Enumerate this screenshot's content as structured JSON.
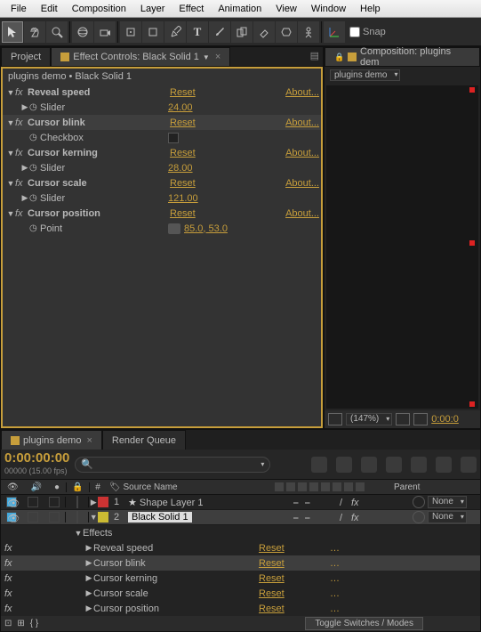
{
  "menu": [
    "File",
    "Edit",
    "Composition",
    "Layer",
    "Effect",
    "Animation",
    "View",
    "Window",
    "Help"
  ],
  "snap_label": "Snap",
  "tabs_left": {
    "project": "Project",
    "effect": "Effect Controls: Black Solid 1"
  },
  "tabs_right": {
    "comp": "Composition: plugins dem",
    "pill": "plugins demo"
  },
  "breadcrumb": "plugins demo • Black Solid 1",
  "effects": [
    {
      "name": "Reveal speed",
      "reset": "Reset",
      "about": "About...",
      "child": "Slider",
      "val": "24.00"
    },
    {
      "name": "Cursor blink",
      "reset": "Reset",
      "about": "About...",
      "child": "Checkbox",
      "ctl": "chk",
      "hl": true
    },
    {
      "name": "Cursor kerning",
      "reset": "Reset",
      "about": "About...",
      "child": "Slider",
      "val": "28.00"
    },
    {
      "name": "Cursor scale",
      "reset": "Reset",
      "about": "About...",
      "child": "Slider",
      "val": "121.00"
    },
    {
      "name": "Cursor position",
      "reset": "Reset",
      "about": "About...",
      "child": "Point",
      "val": "85.0, 53.0",
      "ctl": "cross"
    }
  ],
  "comp_zoom": "(147%)",
  "comp_time": "0:00:0",
  "tl_tabs": {
    "demo": "plugins demo",
    "rq": "Render Queue"
  },
  "timecode": "0:00:00:00",
  "timesub": "00000 (15.00 fps)",
  "columns": {
    "num": "#",
    "source": "Source Name",
    "parent": "Parent"
  },
  "layers": [
    {
      "n": "1",
      "name": "Shape Layer 1",
      "color": "red",
      "star": true,
      "parent": "None"
    },
    {
      "n": "2",
      "name": "Black Solid 1",
      "color": "yel",
      "box": true,
      "hl": true,
      "parent": "None"
    }
  ],
  "effects_lbl": "Effects",
  "tl_effects": [
    {
      "name": "Reveal speed",
      "reset": "Reset"
    },
    {
      "name": "Cursor blink",
      "reset": "Reset",
      "hl": true
    },
    {
      "name": "Cursor kerning",
      "reset": "Reset"
    },
    {
      "name": "Cursor scale",
      "reset": "Reset"
    },
    {
      "name": "Cursor position",
      "reset": "Reset"
    }
  ],
  "toggle_btn": "Toggle Switches / Modes"
}
